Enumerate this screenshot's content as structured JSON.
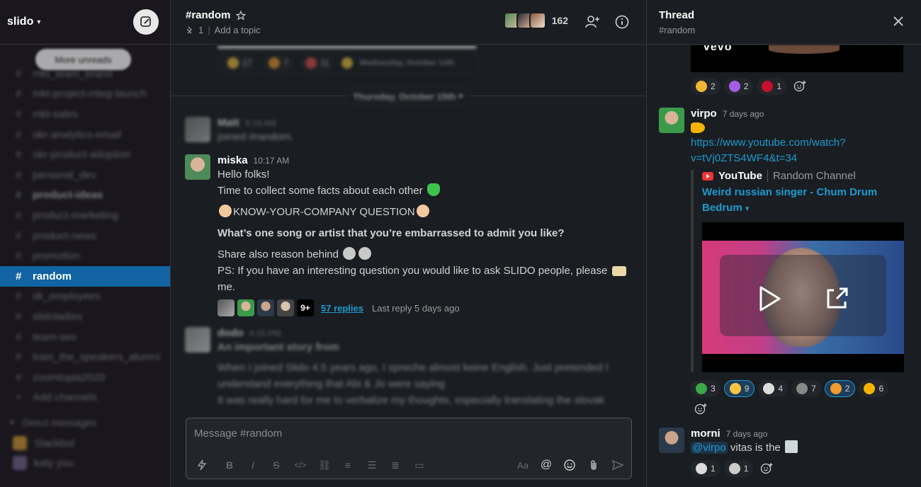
{
  "workspace": {
    "name": "slido",
    "caret": "▾"
  },
  "sidebar": {
    "more_unreads": "More unreads",
    "channels": [
      {
        "name": "mkt_team_brand",
        "bold": false
      },
      {
        "name": "mkt-project-integ-launch",
        "bold": false
      },
      {
        "name": "mkt-sales",
        "bold": false
      },
      {
        "name": "okr-analytics-email",
        "bold": false
      },
      {
        "name": "okr-product-adoption",
        "bold": false
      },
      {
        "name": "personal_dev",
        "bold": false
      },
      {
        "name": "product-ideas",
        "bold": true
      },
      {
        "name": "product-marketing",
        "bold": false
      },
      {
        "name": "product-news",
        "bold": false
      },
      {
        "name": "promotion",
        "bold": false
      },
      {
        "name": "random",
        "bold": true,
        "active": true
      },
      {
        "name": "sk_employees",
        "bold": false
      },
      {
        "name": "slidoladies",
        "bold": false
      },
      {
        "name": "team-seo",
        "bold": false
      },
      {
        "name": "train_the_speakers_alumni",
        "bold": false
      },
      {
        "name": "zoomtopia2020",
        "bold": false
      }
    ],
    "add_channels": "Add channels",
    "dm_header": "Direct messages",
    "dms": [
      {
        "name": "Slackbot",
        "color": "#e2a33a"
      },
      {
        "name": "katy  you",
        "color": "#7d6b9a"
      }
    ]
  },
  "channel": {
    "title": "#random",
    "pins": "1",
    "add_topic": "Add a topic",
    "member_count": "162"
  },
  "messages": {
    "top_date": "Wednesday, October 14th",
    "top_reactions": [
      "17",
      "7",
      "11"
    ],
    "date_divider": "Thursday, October 15th",
    "join": {
      "author": "Matt",
      "time": "9:19 AM",
      "text": "joined #random."
    },
    "main": {
      "author": "miska",
      "time": "10:17 AM",
      "line1": "Hello folks!",
      "line2": "Time to collect some facts about each other",
      "line3": "KNOW-YOUR-COMPANY QUESTION",
      "line4": "What’s one song or artist that you’re embarrassed to admit you like?",
      "line5": "Share also reason behind",
      "line6": "PS: If you have an interesting question you would like to ask SLIDO people, please",
      "line7": "me.",
      "more_badge": "9+",
      "replies": "57 replies",
      "last_reply": "Last reply 5 days ago"
    },
    "next": {
      "author": "dodo",
      "time": "4:15 PM",
      "line1": "An important story from",
      "line2": "When I joined Slido 4.5 years ago, I spreche almost keine English. Just pretended I",
      "line3": "understand everything that Abi & Jo were saying",
      "line4": "It was really hard for me to verbalize my thoughts, especially translating the slovak"
    }
  },
  "composer": {
    "placeholder": "Message #random",
    "format_label": "Aa"
  },
  "thread": {
    "title": "Thread",
    "subtitle": "#random",
    "top_reactions": [
      {
        "count": "2",
        "color": "#f2b636"
      },
      {
        "count": "2",
        "color": "#a45ee5"
      },
      {
        "count": "1",
        "color": "#c8102e"
      }
    ],
    "virpo": {
      "author": "virpo",
      "time": "7 days ago",
      "link1": "https://www.youtube.com/watch?",
      "link2": "v=tVj0ZTS4WF4&t=34",
      "source": "YouTube",
      "channel": "Random Channel",
      "video_title": "Weird russian singer - Chum Drum Bedrum",
      "video_title_caret": "▾",
      "reactions": [
        {
          "count": "3",
          "color": "#3aa846",
          "mine": false
        },
        {
          "count": "9",
          "color": "#f5c542",
          "mine": true
        },
        {
          "count": "4",
          "color": "#dddddd",
          "mine": false
        },
        {
          "count": "7",
          "color": "#888888",
          "mine": false
        },
        {
          "count": "2",
          "color": "#f29b30",
          "mine": true
        },
        {
          "count": "6",
          "color": "#f5b400",
          "mine": false
        }
      ]
    },
    "morni": {
      "author": "morni",
      "time": "7 days ago",
      "mention": "@virpo",
      "text": " vitas is the",
      "reactions": [
        {
          "count": "1",
          "color": "#dddddd"
        },
        {
          "count": "1",
          "color": "#cccccc"
        }
      ]
    }
  }
}
